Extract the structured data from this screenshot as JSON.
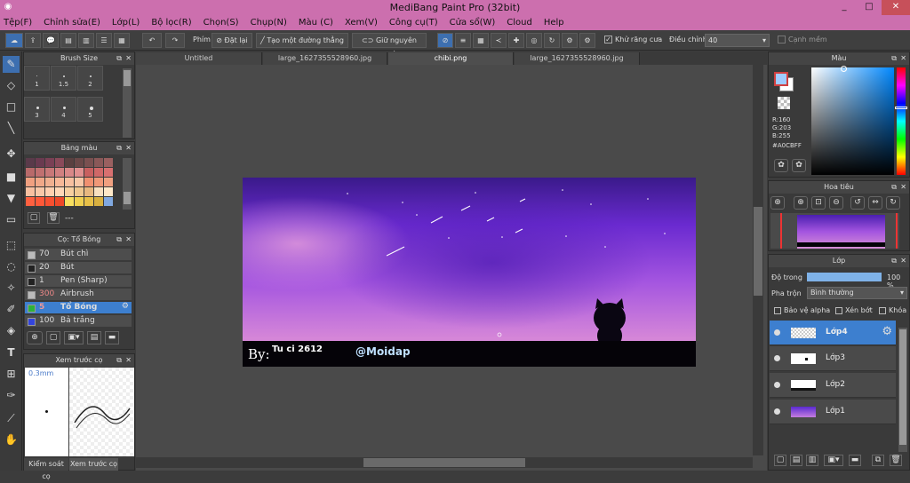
{
  "window": {
    "title": "MediBang Paint Pro (32bit)",
    "controls": [
      "_",
      "□",
      "✕"
    ]
  },
  "menu": [
    "Tệp(F)",
    "Chỉnh sửa(E)",
    "Lớp(L)",
    "Bộ lọc(R)",
    "Chọn(S)",
    "Chụp(N)",
    "Màu (C)",
    "Xem(V)",
    "Công cụ(T)",
    "Cửa sổ(W)",
    "Cloud",
    "Help"
  ],
  "toolbar": {
    "phim_label": "Phím",
    "reset_label": "Đặt lại",
    "straight_label": "Tạo một đường thẳng",
    "keep_edge_label": "Giữ nguyên cạnh",
    "antialias_label": "Khử răng cưa",
    "adjust_label": "Điều chỉnh",
    "adjust_value": "40",
    "soft_edge_label": "Cạnh mềm"
  },
  "tabs": [
    "Untitled",
    "large_1627355528960.jpg",
    "chibi.png",
    "large_1627355528960.jpg"
  ],
  "active_tab": 2,
  "brush_size": {
    "title": "Brush Size",
    "sizes": [
      "1",
      "1.5",
      "2",
      "3",
      "4",
      "5"
    ]
  },
  "palette": {
    "title": "Bảng màu",
    "footer": "---"
  },
  "brushes": {
    "title": "Cọ: Tổ Bóng",
    "items": [
      {
        "size": "70",
        "name": "Bút chì",
        "color": "#bbbbbb"
      },
      {
        "size": "20",
        "name": "Bút",
        "color": "#222222"
      },
      {
        "size": "1",
        "name": "Pen (Sharp)",
        "color": "#222222"
      },
      {
        "size": "300",
        "name": "Airbrush",
        "color": "#bbbbbb"
      },
      {
        "size": "5",
        "name": "Tổ Bóng",
        "color": "#2db33a"
      },
      {
        "size": "100",
        "name": "Bả trắng",
        "color": "#3344dd"
      }
    ],
    "active_index": 4
  },
  "preview": {
    "title": "Xem trước cọ",
    "size": "0.3mm",
    "tabs": [
      "Kiểm soát cọ",
      "Xem trước cọ"
    ]
  },
  "color_panel": {
    "title": "Màu",
    "r": "R:160",
    "g": "G:203",
    "b": "B:255",
    "hex": "#A0CBFF"
  },
  "navigator": {
    "title": "Hoa tiêu"
  },
  "layer_panel": {
    "title": "Lớp",
    "opacity_label": "Độ trong",
    "opacity_value": "100 %",
    "blend_label": "Pha trộn",
    "blend_value": "Bình thường",
    "protect_alpha": "Bảo vệ alpha",
    "clipping": "Xén bớt",
    "lock": "Khóa",
    "layers": [
      "Lớp4",
      "Lớp3",
      "Lớp2",
      "Lớp1"
    ],
    "active_index": 0
  },
  "artwork": {
    "signature": "By:",
    "author": "Tu ci 2612",
    "handle": "@Moidap"
  }
}
